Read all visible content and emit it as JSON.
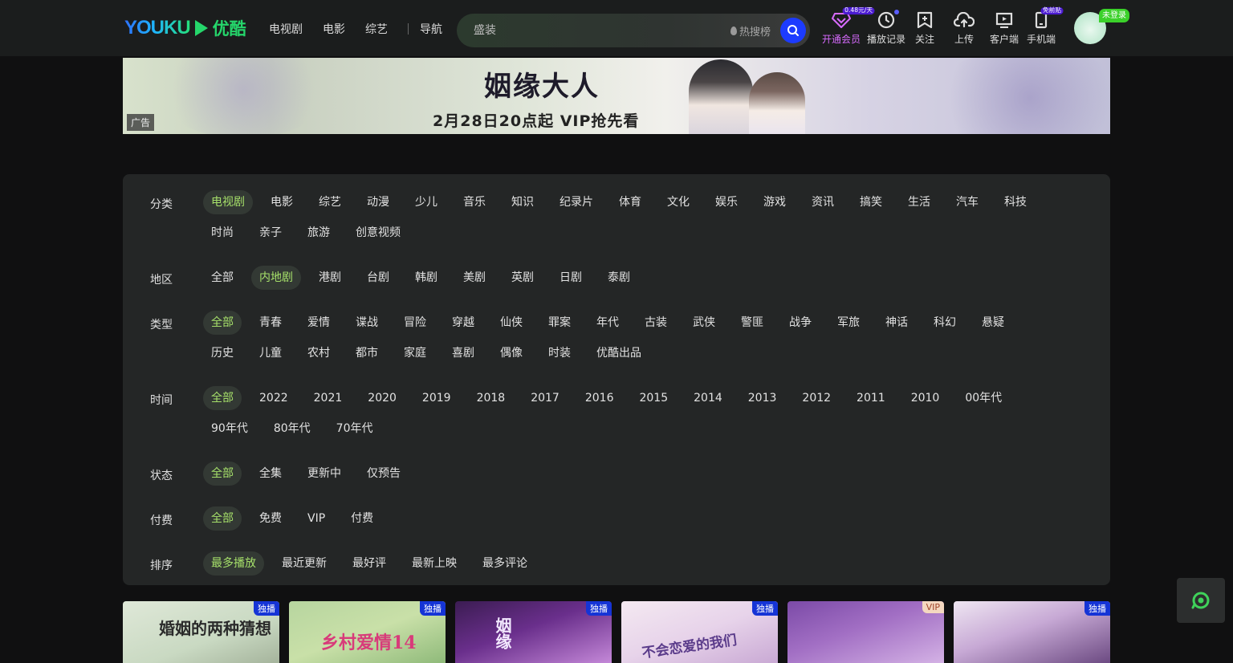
{
  "header": {
    "logo_text": "YOUKU",
    "logo_cn": "优酷",
    "nav": [
      "电视剧",
      "电影",
      "综艺"
    ],
    "guide_label": "导航",
    "search": {
      "placeholder": "盛装",
      "hot_label": "热搜榜"
    },
    "tools": {
      "vip": {
        "label": "开通会员",
        "badge": "0.48元/天"
      },
      "history": {
        "label": "播放记录"
      },
      "follow": {
        "label": "关注"
      },
      "upload": {
        "label": "上传"
      },
      "client": {
        "label": "客户端"
      },
      "mobile": {
        "label": "手机端",
        "badge": "免前贴"
      }
    },
    "login_badge": "未登录"
  },
  "banner": {
    "title": "姻缘大人",
    "subtitle": "2月28日20点起 VIP抢先看",
    "ad_tag": "广告"
  },
  "filters": [
    {
      "label": "分类",
      "options": [
        "电视剧",
        "电影",
        "综艺",
        "动漫",
        "少儿",
        "音乐",
        "知识",
        "纪录片",
        "体育",
        "文化",
        "娱乐",
        "游戏",
        "资讯",
        "搞笑",
        "生活",
        "汽车",
        "科技",
        "时尚",
        "亲子",
        "旅游",
        "创意视频"
      ],
      "active": 0
    },
    {
      "label": "地区",
      "options": [
        "全部",
        "内地剧",
        "港剧",
        "台剧",
        "韩剧",
        "美剧",
        "英剧",
        "日剧",
        "泰剧"
      ],
      "active": 1
    },
    {
      "label": "类型",
      "options": [
        "全部",
        "青春",
        "爱情",
        "谍战",
        "冒险",
        "穿越",
        "仙侠",
        "罪案",
        "年代",
        "古装",
        "武侠",
        "警匪",
        "战争",
        "军旅",
        "神话",
        "科幻",
        "悬疑",
        "历史",
        "儿童",
        "农村",
        "都市",
        "家庭",
        "喜剧",
        "偶像",
        "时装",
        "优酷出品"
      ],
      "active": 0
    },
    {
      "label": "时间",
      "options": [
        "全部",
        "2022",
        "2021",
        "2020",
        "2019",
        "2018",
        "2017",
        "2016",
        "2015",
        "2014",
        "2013",
        "2012",
        "2011",
        "2010",
        "00年代",
        "90年代",
        "80年代",
        "70年代"
      ],
      "active": 0
    },
    {
      "label": "状态",
      "options": [
        "全部",
        "全集",
        "更新中",
        "仅预告"
      ],
      "active": 0
    },
    {
      "label": "付费",
      "options": [
        "全部",
        "免费",
        "VIP",
        "付费"
      ],
      "active": 0
    },
    {
      "label": "排序",
      "options": [
        "最多播放",
        "最近更新",
        "最好评",
        "最新上映",
        "最多评论"
      ],
      "active": 0
    }
  ],
  "cards": [
    {
      "badge": "独播",
      "title": "婚姻的两种猜想",
      "badge_type": "exclusive"
    },
    {
      "badge": "独播",
      "title": "乡村爱情14",
      "badge_type": "exclusive"
    },
    {
      "badge": "独播",
      "title": "姻缘",
      "badge_type": "exclusive"
    },
    {
      "badge": "独播",
      "title": "不会恋爱的我们",
      "badge_type": "exclusive"
    },
    {
      "badge": "VIP",
      "title": "",
      "badge_type": "vip"
    },
    {
      "badge": "独播",
      "title": "",
      "badge_type": "exclusive"
    }
  ]
}
